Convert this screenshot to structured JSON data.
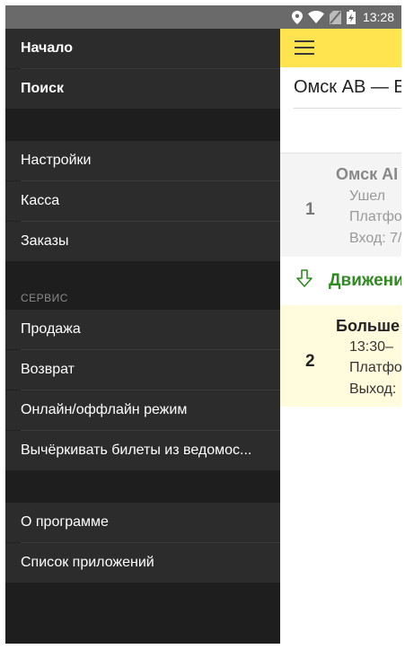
{
  "status_bar": {
    "time": "13:28",
    "icons": [
      "location-icon",
      "wifi-icon",
      "no-sim-icon",
      "battery-charging-icon"
    ]
  },
  "drawer": {
    "group1": [
      {
        "label": "Начало"
      },
      {
        "label": "Поиск"
      }
    ],
    "group2": [
      {
        "label": "Настройки"
      },
      {
        "label": "Касса"
      },
      {
        "label": "Заказы"
      }
    ],
    "service_header": "СЕРВИС",
    "group3": [
      {
        "label": "Продажа"
      },
      {
        "label": "Возврат"
      },
      {
        "label": "Онлайн/оффлайн режим"
      },
      {
        "label": "Вычёркивать билеты из ведомос..."
      }
    ],
    "group4": [
      {
        "label": "О программе"
      },
      {
        "label": "Список приложений"
      }
    ]
  },
  "main": {
    "route_title": "Омск АВ — Б",
    "stops": [
      {
        "number": "1",
        "name": "Омск АІ",
        "line1": "Ушел",
        "line2": "Платфо",
        "line3": "Вход: 7/"
      },
      {
        "number": "2",
        "name": "Больше",
        "line1": "13:30–",
        "line2": "Платфо",
        "line3": "Выход:"
      }
    ],
    "movement_label": "Движени"
  },
  "colors": {
    "app_bar": "#ffe34f",
    "drawer_bg": "#2c2c2c",
    "movement_green": "#2e8b1f",
    "current_stop_bg": "#fffbdc"
  }
}
